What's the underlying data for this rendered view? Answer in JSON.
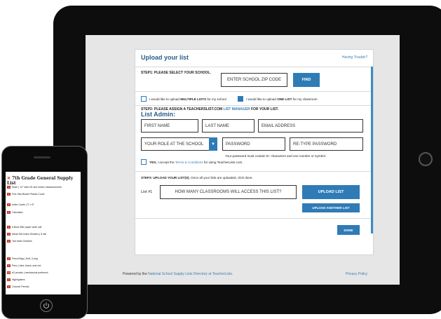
{
  "form": {
    "title": "Upload your list",
    "trouble_link": "Having Trouble?",
    "step1_label": "STEP1: PLEASE SELECT YOUR SCHOOL.",
    "zip_placeholder": "ENTER SCHOOL ZIP CODE",
    "find_label": "FIND",
    "multiple_prefix": "I would like to upload ",
    "multiple_bold": "MULTIPLE LISTS",
    "multiple_suffix": " for my school",
    "one_prefix": "I would like to upload ",
    "one_bold": "ONE LIST",
    "one_suffix": " for my classroom",
    "step2_prefix": "STEP2: PLEASE ASSIGN A TEACHERSLIST.COM ",
    "step2_link": "LIST MANAGER",
    "step2_suffix": " FOR YOUR LIST.",
    "admin_heading": "List Admin:",
    "first_name": "FIRST NAME",
    "last_name": "LAST NAME",
    "email": "EMAIL ADDRESS",
    "role": "YOUR ROLE AT THE SCHOOL",
    "password": "PASSWORD",
    "retype_password": "RE-TYPE PASSWORD",
    "password_hint": "Your password must contain 8+ characters and one number or symbol.",
    "terms_yes": "YES,",
    "terms_mid": " I accept the ",
    "terms_link": "Terms & Conditions",
    "terms_suffix": " for using TeacherLists.com.",
    "step3_bold": "STEP3: UPLOAD YOUR LIST(S).",
    "step3_rest": " Once all your lists are uploaded, click done.",
    "list_label": "List #1",
    "classrooms_placeholder": "HOW MANY CLASSROOMS WILL ACCESS THIS LIST?",
    "upload_list": "UPLOAD LIST",
    "upload_another": "UPLOAD ANOTHER LIST",
    "done": "DONE"
  },
  "footer": {
    "powered_prefix": "Powered by the ",
    "powered_link": "National School Supply Lists Directory at TeacherLists.",
    "privacy": "Privacy Policy"
  },
  "phone": {
    "title": "7th Grade General Supply List",
    "items": [
      {
        "num": "1",
        "text": "Ruler | 12\" with US and metric measurements"
      },
      {
        "num": "2",
        "text": "Five Star Binder Plastic Cover"
      },
      {
        "num": "1",
        "text": "Index Cards | 3\" x 5\""
      },
      {
        "num": "1",
        "text": "Calculator"
      },
      {
        "num": "2",
        "text": "6 Boar filler paper wide rule"
      },
      {
        "num": "1",
        "text": "Mead Tab Index Dividers | 5 tab"
      },
      {
        "num": "1",
        "text": "Tab Index Dividers"
      },
      {
        "num": "1",
        "text": "Pencil Bag | Soft, 3-ring"
      },
      {
        "num": "1",
        "text": "Pens | blue, black, and red"
      },
      {
        "num": "12",
        "text": "#2 pencils | mechanical preferred"
      },
      {
        "num": "2",
        "text": "Highlighters"
      },
      {
        "num": "1",
        "text": "Colored Pencils"
      }
    ]
  },
  "colors": {
    "accent": "#2f7bb6",
    "heading": "#2a5d8f",
    "list_number": "#c23b2a"
  }
}
